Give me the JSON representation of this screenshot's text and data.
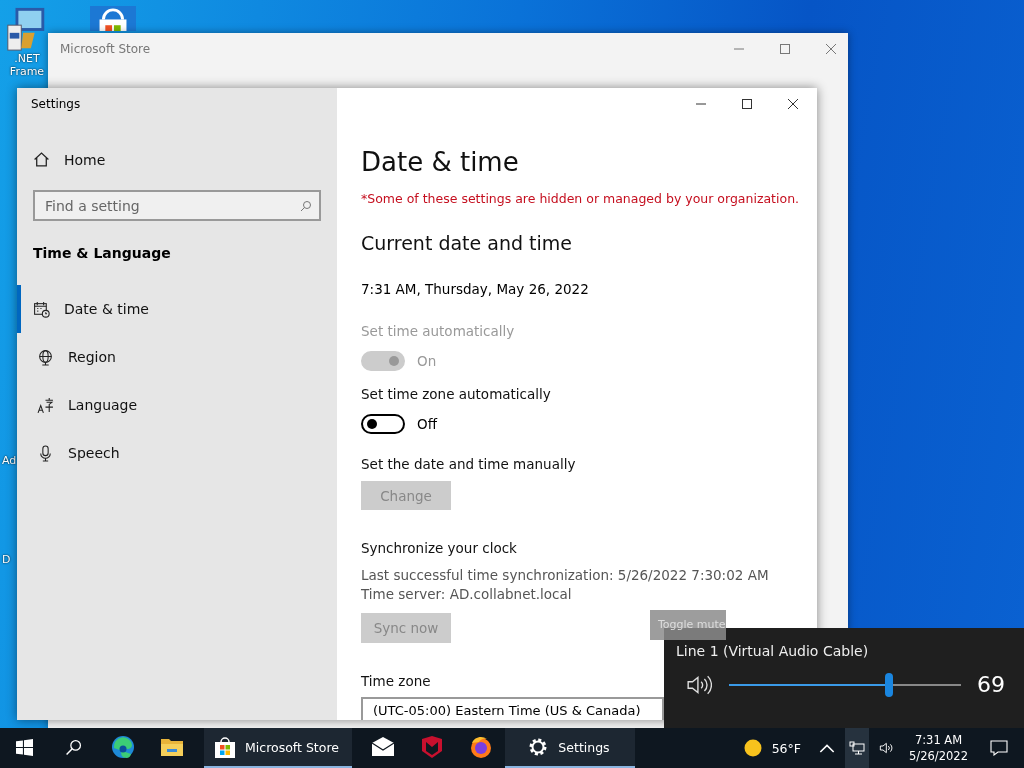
{
  "desktop": {
    "icons": [
      {
        "kind": "installer",
        "label_lines": [
          ".NET",
          "Frame"
        ]
      },
      {
        "kind": "store"
      }
    ],
    "fragments": [
      "Ad",
      "D"
    ]
  },
  "store_window": {
    "title": "Microsoft Store"
  },
  "settings_window": {
    "title": "Settings",
    "sidebar": {
      "home": "Home",
      "search": {
        "placeholder": "Find a setting"
      },
      "section": "Time & Language",
      "items": [
        {
          "kind": "calendar",
          "label": "Date & time",
          "selected": true
        },
        {
          "kind": "globe",
          "label": "Region",
          "selected": false
        },
        {
          "kind": "language",
          "label": "Language",
          "selected": false
        },
        {
          "kind": "microphone",
          "label": "Speech",
          "selected": false
        }
      ]
    },
    "content": {
      "heading": "Date & time",
      "notice": "*Some of these settings are hidden or managed by your organization.",
      "subheading": "Current date and time",
      "current": "7:31 AM, Thursday, May 26, 2022",
      "toggles": [
        {
          "label": "Set time automatically",
          "on": true,
          "disabled": true,
          "state_text": "On"
        },
        {
          "label": "Set time zone automatically",
          "on": false,
          "disabled": false,
          "state_text": "Off"
        }
      ],
      "manual": {
        "label": "Set the date and time manually",
        "button": "Change",
        "disabled": true
      },
      "sync": {
        "heading": "Synchronize your clock",
        "lines": [
          "Last successful time synchronization: 5/26/2022 7:30:02 AM",
          "Time server: AD.collabnet.local"
        ],
        "button": "Sync now",
        "disabled": true
      },
      "time_zone": {
        "label": "Time zone",
        "value": "(UTC-05:00) Eastern Time (US & Canada)"
      }
    }
  },
  "volume_flyout": {
    "device": "Line 1 (Virtual Audio Cable)",
    "level": 0.69,
    "reading": "69",
    "tooltip": "Toggle mute"
  },
  "taskbar": {
    "apps": [
      {
        "kind": "start",
        "running": false
      },
      {
        "kind": "search",
        "running": false
      },
      {
        "kind": "edge",
        "running": false
      },
      {
        "kind": "explorer",
        "running": false
      },
      {
        "kind": "store",
        "label": "Microsoft Store",
        "running": true
      },
      {
        "kind": "mail",
        "running": false
      },
      {
        "kind": "shield",
        "running": false
      },
      {
        "kind": "firefox",
        "running": false
      },
      {
        "kind": "settings",
        "label": "Settings",
        "running": true
      }
    ],
    "weather": "56°F",
    "time": "7:31 AM",
    "date": "5/26/2022"
  }
}
